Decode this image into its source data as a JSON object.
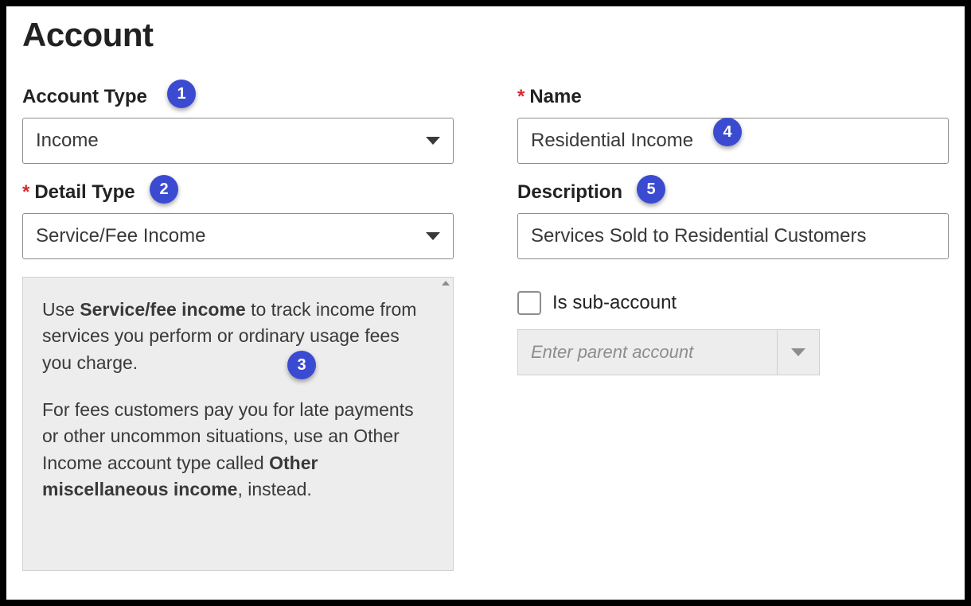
{
  "page_title": "Account",
  "accent_color": "#3b4bd1",
  "required_marker": "*",
  "left": {
    "account_type": {
      "label": "Account Type",
      "value": "Income"
    },
    "detail_type": {
      "label": "Detail Type",
      "required": true,
      "value": "Service/Fee Income"
    },
    "helper": {
      "p1_pre": "Use ",
      "p1_strong": "Service/fee income",
      "p1_post": " to track income from services you perform or ordinary usage fees you charge.",
      "p2_pre": "For fees customers pay you for late payments or other uncommon situations, use an Other Income account type called ",
      "p2_strong": "Other miscellaneous income",
      "p2_post": ", instead."
    }
  },
  "right": {
    "name": {
      "label": "Name",
      "required": true,
      "value": "Residential Income"
    },
    "description": {
      "label": "Description",
      "value": "Services Sold to Residential Customers"
    },
    "sub_account": {
      "label": "Is sub-account",
      "checked": false,
      "parent_placeholder": "Enter parent account"
    }
  },
  "annotations": {
    "b1": "1",
    "b2": "2",
    "b3": "3",
    "b4": "4",
    "b5": "5"
  }
}
